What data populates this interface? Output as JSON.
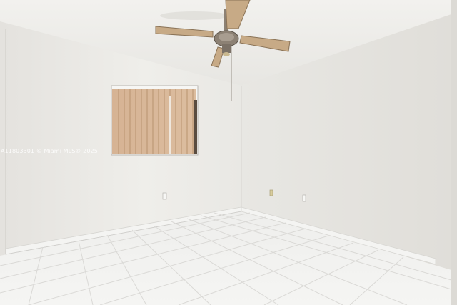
{
  "photo": {
    "watermark": "A11803301 © Miami MLS® 2025"
  },
  "colors": {
    "ceiling": "#efeeea",
    "left_wall": "#eceae6",
    "right_wall": "#e6e4df",
    "floor_tile": "#f1f1ef",
    "grout": "#d9d8d6",
    "baseboard": "#f4f4f2",
    "blinds": "#d9b99b",
    "fan_blade": "#c7aa86",
    "fan_metal": "#8c8174"
  }
}
